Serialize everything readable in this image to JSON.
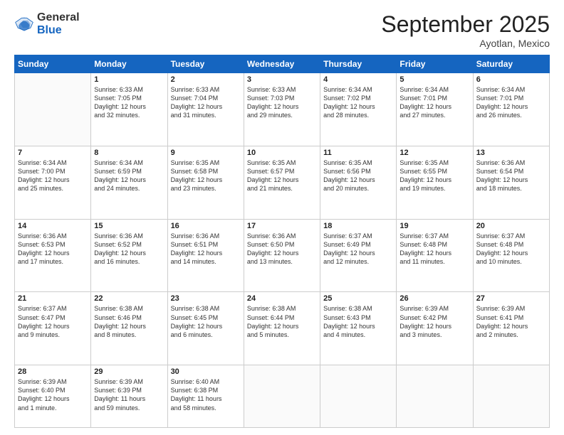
{
  "header": {
    "logo_line1": "General",
    "logo_line2": "Blue",
    "month": "September 2025",
    "location": "Ayotlan, Mexico"
  },
  "days_of_week": [
    "Sunday",
    "Monday",
    "Tuesday",
    "Wednesday",
    "Thursday",
    "Friday",
    "Saturday"
  ],
  "weeks": [
    [
      {
        "day": "",
        "info": ""
      },
      {
        "day": "1",
        "info": "Sunrise: 6:33 AM\nSunset: 7:05 PM\nDaylight: 12 hours\nand 32 minutes."
      },
      {
        "day": "2",
        "info": "Sunrise: 6:33 AM\nSunset: 7:04 PM\nDaylight: 12 hours\nand 31 minutes."
      },
      {
        "day": "3",
        "info": "Sunrise: 6:33 AM\nSunset: 7:03 PM\nDaylight: 12 hours\nand 29 minutes."
      },
      {
        "day": "4",
        "info": "Sunrise: 6:34 AM\nSunset: 7:02 PM\nDaylight: 12 hours\nand 28 minutes."
      },
      {
        "day": "5",
        "info": "Sunrise: 6:34 AM\nSunset: 7:01 PM\nDaylight: 12 hours\nand 27 minutes."
      },
      {
        "day": "6",
        "info": "Sunrise: 6:34 AM\nSunset: 7:01 PM\nDaylight: 12 hours\nand 26 minutes."
      }
    ],
    [
      {
        "day": "7",
        "info": "Sunrise: 6:34 AM\nSunset: 7:00 PM\nDaylight: 12 hours\nand 25 minutes."
      },
      {
        "day": "8",
        "info": "Sunrise: 6:34 AM\nSunset: 6:59 PM\nDaylight: 12 hours\nand 24 minutes."
      },
      {
        "day": "9",
        "info": "Sunrise: 6:35 AM\nSunset: 6:58 PM\nDaylight: 12 hours\nand 23 minutes."
      },
      {
        "day": "10",
        "info": "Sunrise: 6:35 AM\nSunset: 6:57 PM\nDaylight: 12 hours\nand 21 minutes."
      },
      {
        "day": "11",
        "info": "Sunrise: 6:35 AM\nSunset: 6:56 PM\nDaylight: 12 hours\nand 20 minutes."
      },
      {
        "day": "12",
        "info": "Sunrise: 6:35 AM\nSunset: 6:55 PM\nDaylight: 12 hours\nand 19 minutes."
      },
      {
        "day": "13",
        "info": "Sunrise: 6:36 AM\nSunset: 6:54 PM\nDaylight: 12 hours\nand 18 minutes."
      }
    ],
    [
      {
        "day": "14",
        "info": "Sunrise: 6:36 AM\nSunset: 6:53 PM\nDaylight: 12 hours\nand 17 minutes."
      },
      {
        "day": "15",
        "info": "Sunrise: 6:36 AM\nSunset: 6:52 PM\nDaylight: 12 hours\nand 16 minutes."
      },
      {
        "day": "16",
        "info": "Sunrise: 6:36 AM\nSunset: 6:51 PM\nDaylight: 12 hours\nand 14 minutes."
      },
      {
        "day": "17",
        "info": "Sunrise: 6:36 AM\nSunset: 6:50 PM\nDaylight: 12 hours\nand 13 minutes."
      },
      {
        "day": "18",
        "info": "Sunrise: 6:37 AM\nSunset: 6:49 PM\nDaylight: 12 hours\nand 12 minutes."
      },
      {
        "day": "19",
        "info": "Sunrise: 6:37 AM\nSunset: 6:48 PM\nDaylight: 12 hours\nand 11 minutes."
      },
      {
        "day": "20",
        "info": "Sunrise: 6:37 AM\nSunset: 6:48 PM\nDaylight: 12 hours\nand 10 minutes."
      }
    ],
    [
      {
        "day": "21",
        "info": "Sunrise: 6:37 AM\nSunset: 6:47 PM\nDaylight: 12 hours\nand 9 minutes."
      },
      {
        "day": "22",
        "info": "Sunrise: 6:38 AM\nSunset: 6:46 PM\nDaylight: 12 hours\nand 8 minutes."
      },
      {
        "day": "23",
        "info": "Sunrise: 6:38 AM\nSunset: 6:45 PM\nDaylight: 12 hours\nand 6 minutes."
      },
      {
        "day": "24",
        "info": "Sunrise: 6:38 AM\nSunset: 6:44 PM\nDaylight: 12 hours\nand 5 minutes."
      },
      {
        "day": "25",
        "info": "Sunrise: 6:38 AM\nSunset: 6:43 PM\nDaylight: 12 hours\nand 4 minutes."
      },
      {
        "day": "26",
        "info": "Sunrise: 6:39 AM\nSunset: 6:42 PM\nDaylight: 12 hours\nand 3 minutes."
      },
      {
        "day": "27",
        "info": "Sunrise: 6:39 AM\nSunset: 6:41 PM\nDaylight: 12 hours\nand 2 minutes."
      }
    ],
    [
      {
        "day": "28",
        "info": "Sunrise: 6:39 AM\nSunset: 6:40 PM\nDaylight: 12 hours\nand 1 minute."
      },
      {
        "day": "29",
        "info": "Sunrise: 6:39 AM\nSunset: 6:39 PM\nDaylight: 11 hours\nand 59 minutes."
      },
      {
        "day": "30",
        "info": "Sunrise: 6:40 AM\nSunset: 6:38 PM\nDaylight: 11 hours\nand 58 minutes."
      },
      {
        "day": "",
        "info": ""
      },
      {
        "day": "",
        "info": ""
      },
      {
        "day": "",
        "info": ""
      },
      {
        "day": "",
        "info": ""
      }
    ]
  ]
}
